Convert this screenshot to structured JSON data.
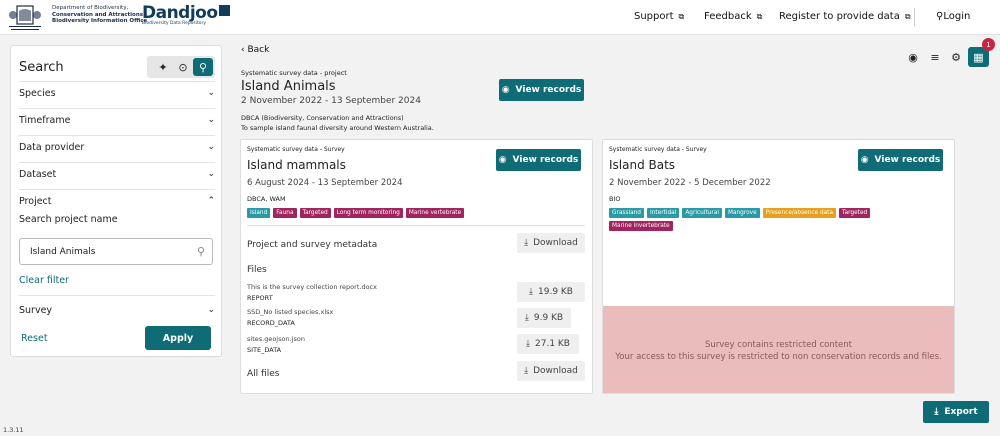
{
  "header": {
    "dept_lines": [
      "Department of Biodiversity,",
      "Conservation and Attractions",
      "Biodiversity Information Office"
    ],
    "brand_name": "Dandjoo",
    "brand_sub": "Biodiversity Data Repository",
    "nav": {
      "support": "Support",
      "feedback": "Feedback",
      "register": "Register to provide data",
      "login": "Login"
    }
  },
  "sidebar": {
    "title": "Search",
    "filters": {
      "species": "Species",
      "timeframe": "Timeframe",
      "data_provider": "Data provider",
      "dataset": "Dataset",
      "project": "Project",
      "survey": "Survey"
    },
    "project_label": "Search project name",
    "project_value": "Island Animals",
    "clear_filter": "Clear filter",
    "reset": "Reset",
    "apply": "Apply"
  },
  "version": "1.3.11",
  "back": "Back",
  "project": {
    "kicker": "Systematic survey data - project",
    "title": "Island Animals",
    "dates": "2 November 2022 - 13 September 2024",
    "org": "DBCA (Biodiversity, Conservation and Attractions)",
    "description": "To sample island faunal diversity around Western Australia.",
    "view_records": "View records"
  },
  "toolbar": {
    "badge": "1"
  },
  "survey1": {
    "kicker": "Systematic survey data - Survey",
    "title": "Island mammals",
    "dates": "6 August 2024 - 13 September 2024",
    "org": "DBCA, WAM",
    "view_records": "View records",
    "tags": [
      {
        "label": "Island",
        "color": "#2a9aa6"
      },
      {
        "label": "Fauna",
        "color": "#a0245e"
      },
      {
        "label": "Targeted",
        "color": "#a0245e"
      },
      {
        "label": "Long term monitoring",
        "color": "#a0245e"
      },
      {
        "label": "Marine vertebrate",
        "color": "#a0245e"
      }
    ],
    "metadata_label": "Project and survey metadata",
    "download": "Download",
    "files_label": "Files",
    "files": [
      {
        "name": "This is the survey collection report.docx",
        "type": "REPORT",
        "size": "19.9 KB"
      },
      {
        "name": "SSD_No listed species.xlsx",
        "type": "RECORD_DATA",
        "size": "9.9 KB"
      },
      {
        "name": "sites.geojson.json",
        "type": "SITE_DATA",
        "size": "27.1 KB"
      }
    ],
    "all_files_label": "All files",
    "all_download": "Download"
  },
  "survey2": {
    "kicker": "Systematic survey data - Survey",
    "title": "Island Bats",
    "dates": "2 November 2022 - 5 December 2022",
    "org": "BIO",
    "view_records": "View records",
    "tags": [
      {
        "label": "Grassland",
        "color": "#2a9aa6"
      },
      {
        "label": "Intertidal",
        "color": "#2a9aa6"
      },
      {
        "label": "Agricultural",
        "color": "#2a9aa6"
      },
      {
        "label": "Mangrove",
        "color": "#2a9aa6"
      },
      {
        "label": "Presence/absence data",
        "color": "#e6a01e"
      },
      {
        "label": "Targeted",
        "color": "#a0245e"
      },
      {
        "label": "Marine invertebrate",
        "color": "#a0245e"
      }
    ],
    "restricted_title": "Survey contains restricted content",
    "restricted_msg": "Your access to this survey is restricted to non conservation records and files."
  },
  "export": "Export"
}
